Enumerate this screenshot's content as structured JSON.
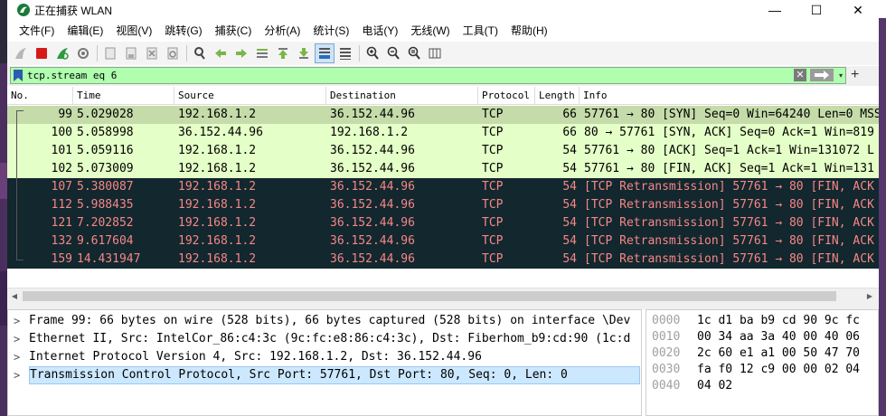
{
  "window": {
    "title": "正在捕获 WLAN",
    "minimize": "—",
    "maximize": "☐",
    "close": "✕"
  },
  "menu": [
    "文件(F)",
    "编辑(E)",
    "视图(V)",
    "跳转(G)",
    "捕获(C)",
    "分析(A)",
    "统计(S)",
    "电话(Y)",
    "无线(W)",
    "工具(T)",
    "帮助(H)"
  ],
  "filter": {
    "value": "tcp.stream eq 6",
    "clear_label": "✕",
    "dropdown_label": "▾",
    "add_label": "+"
  },
  "columns": [
    "No.",
    "Time",
    "Source",
    "Destination",
    "Protocol",
    "Length",
    "Info"
  ],
  "packets": [
    {
      "no": "99",
      "time": "5.029028",
      "src": "192.168.1.2",
      "dst": "36.152.44.96",
      "proto": "TCP",
      "len": "66",
      "info": "57761 → 80 [SYN] Seq=0 Win=64240 Len=0 MSS",
      "style": "sel"
    },
    {
      "no": "100",
      "time": "5.058998",
      "src": "36.152.44.96",
      "dst": "192.168.1.2",
      "proto": "TCP",
      "len": "66",
      "info": "80 → 57761 [SYN, ACK] Seq=0 Ack=1 Win=819",
      "style": "ok"
    },
    {
      "no": "101",
      "time": "5.059116",
      "src": "192.168.1.2",
      "dst": "36.152.44.96",
      "proto": "TCP",
      "len": "54",
      "info": "57761 → 80 [ACK] Seq=1 Ack=1 Win=131072 L",
      "style": "ok"
    },
    {
      "no": "102",
      "time": "5.073009",
      "src": "192.168.1.2",
      "dst": "36.152.44.96",
      "proto": "TCP",
      "len": "54",
      "info": "57761 → 80 [FIN, ACK] Seq=1 Ack=1 Win=131",
      "style": "ok"
    },
    {
      "no": "107",
      "time": "5.380087",
      "src": "192.168.1.2",
      "dst": "36.152.44.96",
      "proto": "TCP",
      "len": "54",
      "info": "[TCP Retransmission] 57761 → 80 [FIN, ACK",
      "style": "retx"
    },
    {
      "no": "112",
      "time": "5.988435",
      "src": "192.168.1.2",
      "dst": "36.152.44.96",
      "proto": "TCP",
      "len": "54",
      "info": "[TCP Retransmission] 57761 → 80 [FIN, ACK",
      "style": "retx"
    },
    {
      "no": "121",
      "time": "7.202852",
      "src": "192.168.1.2",
      "dst": "36.152.44.96",
      "proto": "TCP",
      "len": "54",
      "info": "[TCP Retransmission] 57761 → 80 [FIN, ACK",
      "style": "retx"
    },
    {
      "no": "132",
      "time": "9.617604",
      "src": "192.168.1.2",
      "dst": "36.152.44.96",
      "proto": "TCP",
      "len": "54",
      "info": "[TCP Retransmission] 57761 → 80 [FIN, ACK",
      "style": "retx"
    },
    {
      "no": "159",
      "time": "14.431947",
      "src": "192.168.1.2",
      "dst": "36.152.44.96",
      "proto": "TCP",
      "len": "54",
      "info": "[TCP Retransmission] 57761 → 80 [FIN, ACK",
      "style": "retx"
    }
  ],
  "details": [
    {
      "expander": ">",
      "text": "Frame 99: 66 bytes on wire (528 bits), 66 bytes captured (528 bits) on interface \\Dev"
    },
    {
      "expander": ">",
      "text": "Ethernet II, Src: IntelCor_86:c4:3c (9c:fc:e8:86:c4:3c), Dst: Fiberhom_b9:cd:90 (1c:d"
    },
    {
      "expander": ">",
      "text": "Internet Protocol Version 4, Src: 192.168.1.2, Dst: 36.152.44.96"
    },
    {
      "expander": ">",
      "text": "Transmission Control Protocol, Src Port: 57761, Dst Port: 80, Seq: 0, Len: 0"
    }
  ],
  "bytes": [
    {
      "offset": "0000",
      "hex": "1c d1 ba b9 cd 90 9c fc"
    },
    {
      "offset": "0010",
      "hex": "00 34 aa 3a 40 00 40 06"
    },
    {
      "offset": "0020",
      "hex": "2c 60 e1 a1 00 50 47 70"
    },
    {
      "offset": "0030",
      "hex": "fa f0 12 c9 00 00 02 04"
    },
    {
      "offset": "0040",
      "hex": "04 02"
    }
  ],
  "colors": {
    "selected_row": "#c5dba9",
    "tcp_row": "#e4ffc7",
    "retransmission_row_bg": "#12272e",
    "retransmission_row_fg": "#f78787",
    "filter_valid": "#afffaf",
    "detail_selected": "#cce8ff"
  },
  "icons": [
    "shark-fin-start",
    "stop-square",
    "restart-fin",
    "options-gear",
    "open-file",
    "save-file",
    "close-file",
    "reload",
    "find-magnifier",
    "go-back-arrow",
    "go-forward-arrow",
    "go-to-packet",
    "first-packet",
    "last-packet",
    "autoscroll",
    "colorize",
    "zoom-in",
    "zoom-out",
    "normal-size",
    "resize-columns"
  ]
}
